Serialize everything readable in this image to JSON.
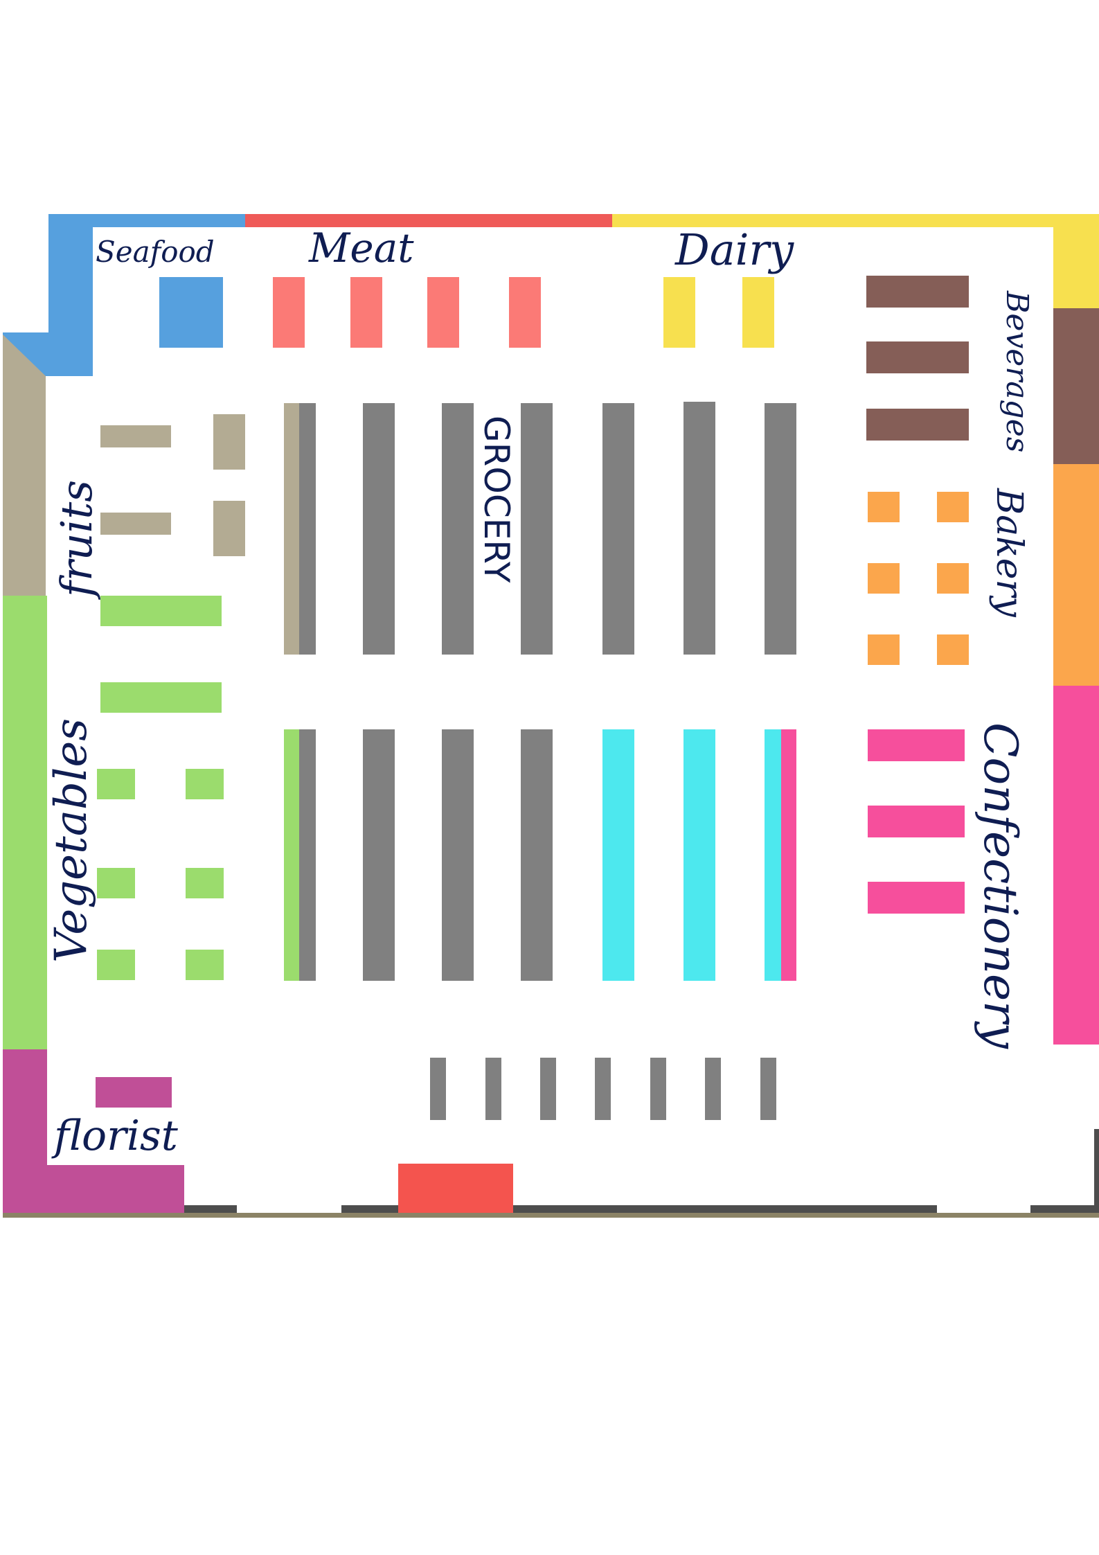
{
  "labels": {
    "seafood": "Seafood",
    "meat": "Meat",
    "dairy": "Dairy",
    "beverages": "Beverages",
    "bakery": "Bakery",
    "confectionery": "Confectionery",
    "fruits": "fruits",
    "vegetables": "Vegetables",
    "grocery": "GROCERY",
    "florist": "florist"
  },
  "colors": {
    "seafood": "#56a0de",
    "meat": "#fb7a76",
    "meat_wall": "#ef5a58",
    "dairy": "#f7e04f",
    "beverages": "#855e57",
    "bakery": "#fba64c",
    "confectionery": "#f64f9c",
    "fruits": "#b3ab93",
    "vegetables": "#9bdc6d",
    "florist": "#c04f97",
    "grocery_shelf": "#808080",
    "cooler_shelf": "#4de8ee",
    "checkout": "#808080",
    "entrance": "#f4544e",
    "floor_edge": "#8b8366",
    "door_frame": "#4d4d4d",
    "label_ink": "#0f1d52"
  }
}
